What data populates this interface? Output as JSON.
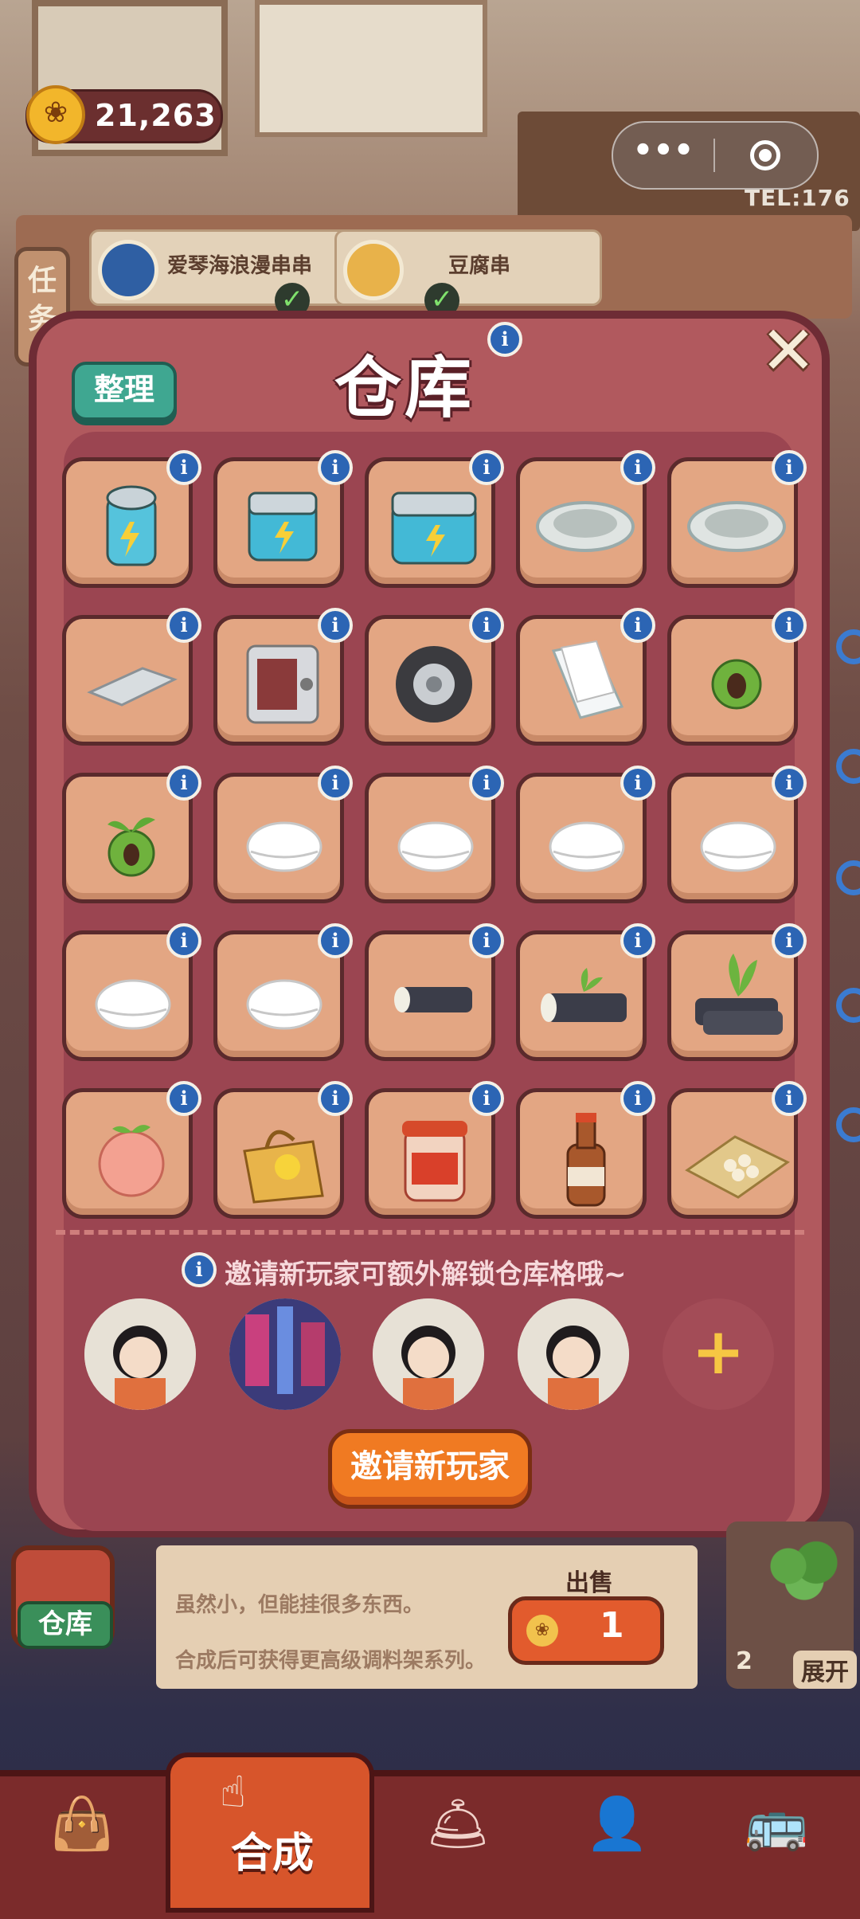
{
  "hud": {
    "paw_count": "21,263",
    "capsule_more": "•••",
    "tel_text": "TEL:176"
  },
  "background": {
    "task_tab_label": "任务",
    "orders": [
      {
        "name": "爱琴海浪漫串串",
        "done": true
      },
      {
        "name": "豆腐串",
        "done": true
      }
    ]
  },
  "warehouse": {
    "title": "仓库",
    "sort_label": "整理",
    "close_label": "✕",
    "info_label": "i",
    "items": [
      {
        "name": "battery-small-icon"
      },
      {
        "name": "battery-medium-icon"
      },
      {
        "name": "battery-large-icon"
      },
      {
        "name": "stone-bowl-icon"
      },
      {
        "name": "stone-bowl-icon"
      },
      {
        "name": "metal-plate-icon"
      },
      {
        "name": "safe-box-icon"
      },
      {
        "name": "tire-icon"
      },
      {
        "name": "paper-sheets-icon"
      },
      {
        "name": "seed-icon"
      },
      {
        "name": "sprout-seed-icon"
      },
      {
        "name": "steamed-bun-icon"
      },
      {
        "name": "steamed-bun-icon"
      },
      {
        "name": "steamed-bun-icon"
      },
      {
        "name": "steamed-bun-icon"
      },
      {
        "name": "steamed-bun-icon"
      },
      {
        "name": "steamed-bun-icon"
      },
      {
        "name": "sugarcane-icon"
      },
      {
        "name": "sugarcane-sprout-icon"
      },
      {
        "name": "sugarcane-bundle-icon"
      },
      {
        "name": "pink-pomelo-icon"
      },
      {
        "name": "shopping-bag-icon"
      },
      {
        "name": "chili-jar-icon"
      },
      {
        "name": "sauce-bottle-icon"
      },
      {
        "name": "beans-bag-icon"
      }
    ],
    "invite_hint": "邀请新玩家可额外解锁仓库格哦~",
    "invite_button": "邀请新玩家",
    "add_label": "+"
  },
  "item_panel": {
    "description_line1": "虽然小，但能挂很多东西。",
    "description_line2": "合成后可获得更高级调料架系列。",
    "sell_label": "出售",
    "sell_price": "1",
    "warehouse_tab_label": "仓库",
    "expand_count": "2",
    "expand_label": "展开"
  },
  "bottom_nav": {
    "center_label": "合成"
  },
  "colors": {
    "modal_bg": "#b1595e",
    "modal_border": "#6e2c35",
    "cell_bg": "#e3a683",
    "sort_button": "#3fa791",
    "invite_button": "#f07a22",
    "info_badge": "#2c65b4",
    "bottom_bar": "#7b2b2b"
  }
}
